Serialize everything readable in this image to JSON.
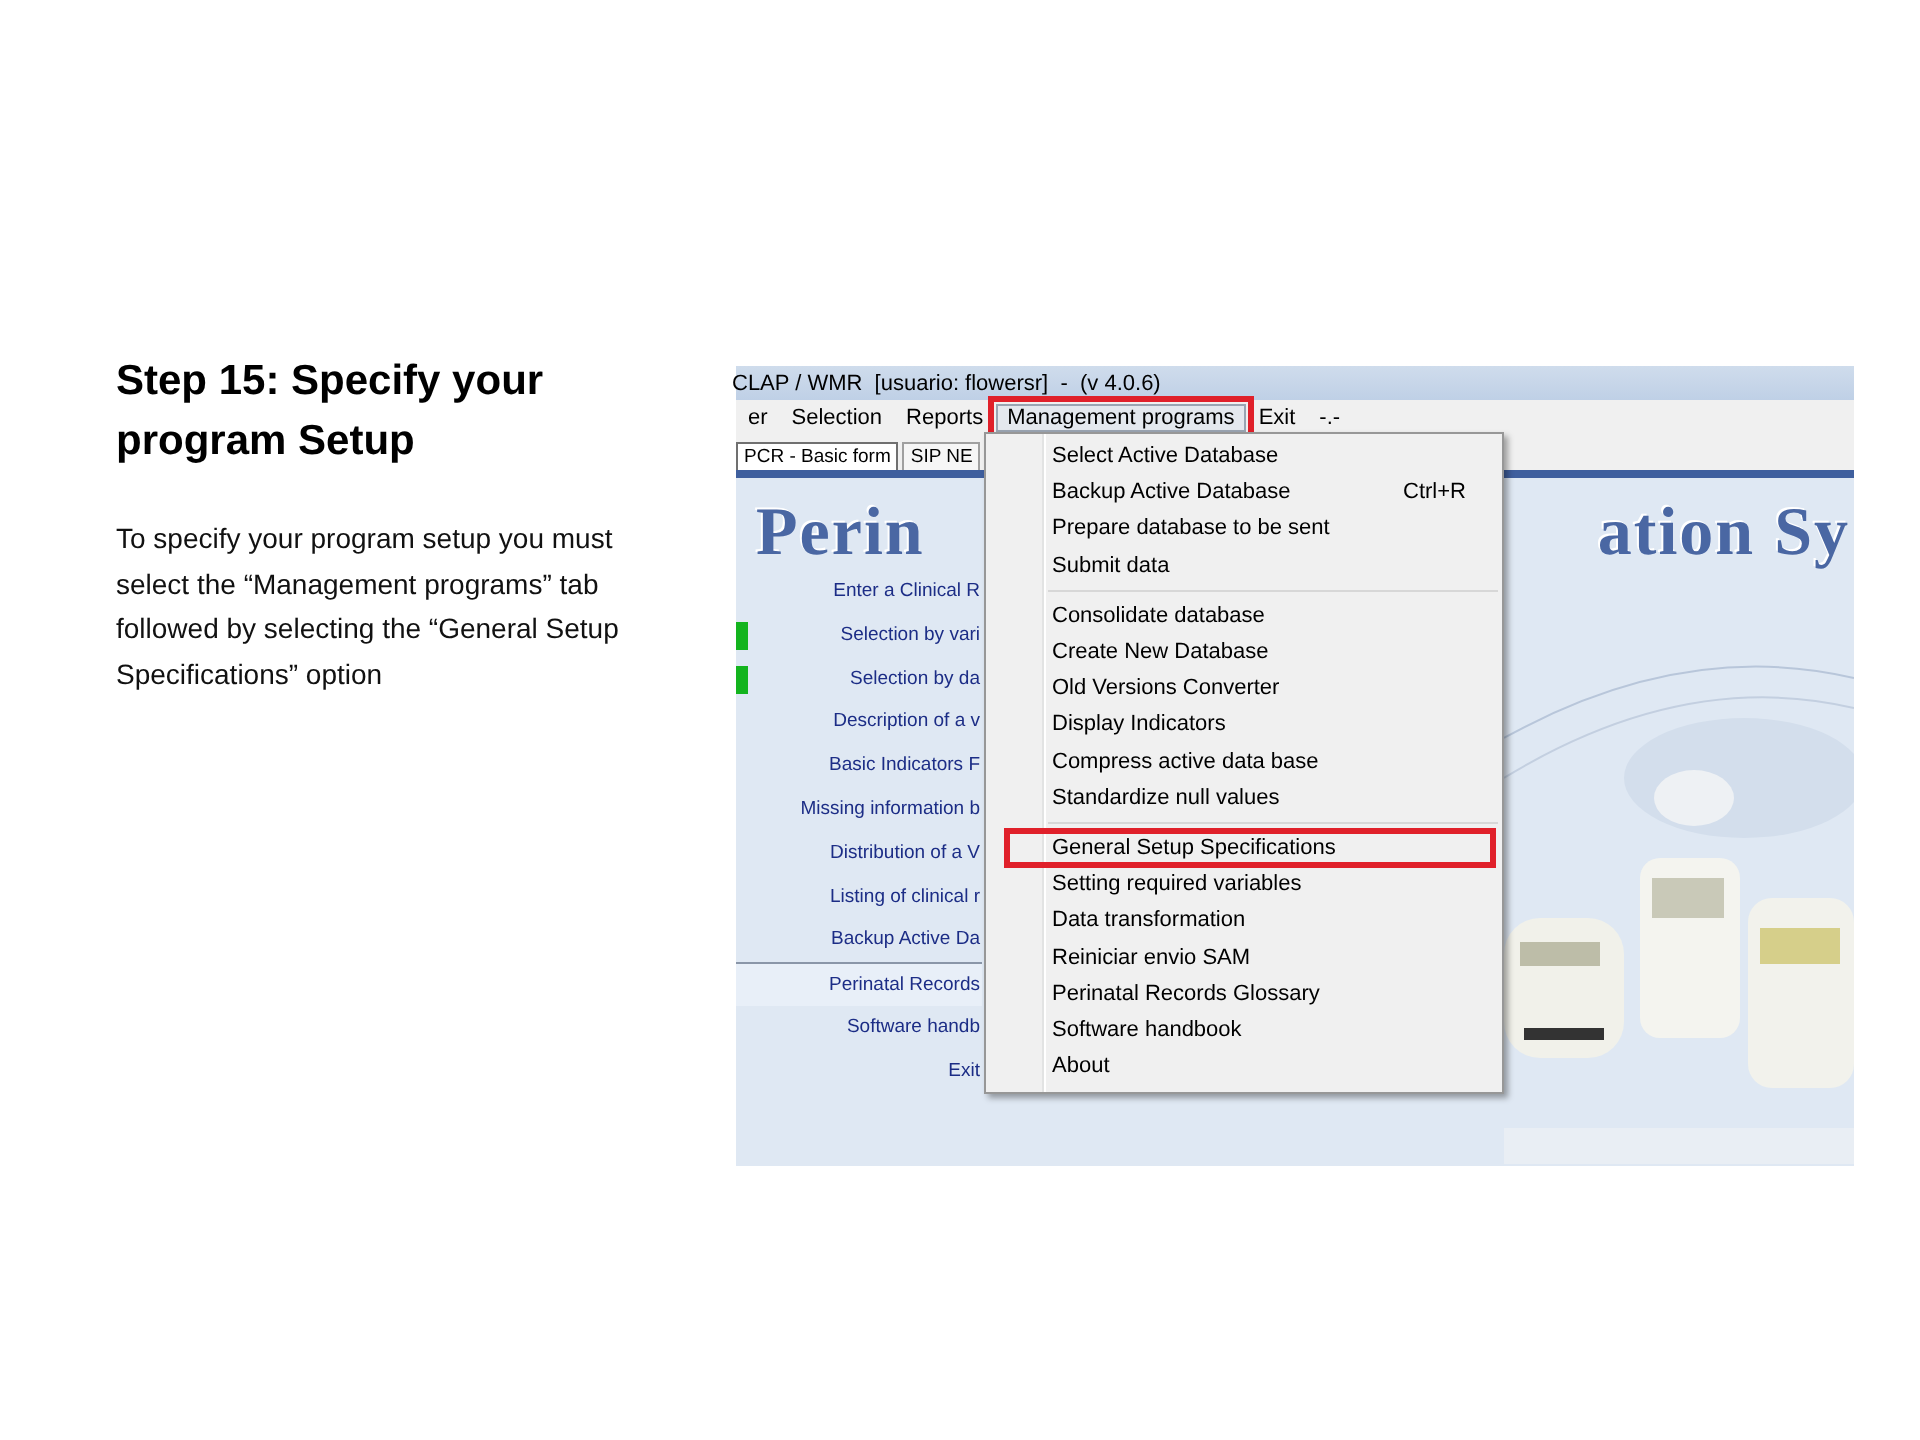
{
  "slide": {
    "title": "Step 15: Specify your program Setup",
    "body": "To specify your program setup you must select the “Management programs” tab followed by selecting the “General Setup Specifications” option"
  },
  "screenshot": {
    "window_title": "CLAP / WMR  [usuario: flowersr]  -  (v 4.0.6)",
    "menu": [
      {
        "label": "er",
        "selected": false,
        "annotated": false
      },
      {
        "label": "Selection",
        "selected": false,
        "annotated": false
      },
      {
        "label": "Reports",
        "selected": false,
        "annotated": false
      },
      {
        "label": "Management programs",
        "selected": true,
        "annotated": true
      },
      {
        "label": "Exit",
        "selected": false,
        "annotated": false
      },
      {
        "label": "-.-",
        "selected": false,
        "annotated": false
      }
    ],
    "tabs": [
      {
        "label": "PCR - Basic form",
        "selected": true
      },
      {
        "label": "SIP NE",
        "selected": false
      }
    ],
    "banner": [
      "Perin",
      "ation Sy"
    ],
    "nav_items": [
      {
        "label": "Enter a Clinical R",
        "selected": false,
        "flag": false
      },
      {
        "label": "Selection by vari",
        "selected": false,
        "flag": true
      },
      {
        "label": "Selection by da",
        "selected": false,
        "flag": true
      },
      {
        "label": "Description of a v",
        "selected": false,
        "flag": false
      },
      {
        "label": "Basic Indicators F",
        "selected": false,
        "flag": false
      },
      {
        "label": "Missing information b",
        "selected": false,
        "flag": false
      },
      {
        "label": "Distribution of a V",
        "selected": false,
        "flag": false
      },
      {
        "label": "Listing of clinical r",
        "selected": false,
        "flag": false
      },
      {
        "label": "Backup Active Da",
        "selected": false,
        "flag": false
      },
      {
        "label": "Perinatal Records",
        "selected": true,
        "flag": false
      },
      {
        "label": "Software handb",
        "selected": false,
        "flag": false
      },
      {
        "label": "Exit",
        "selected": false,
        "flag": false
      }
    ],
    "dropdown": [
      [
        {
          "label": "Select Active Database",
          "annotated": false
        },
        {
          "label": "Backup Active Database",
          "shortcut": "Ctrl+R",
          "annotated": false
        },
        {
          "label": "Prepare database to be sent",
          "annotated": false
        },
        {
          "label": "Submit data",
          "annotated": false
        }
      ],
      [
        {
          "label": "Consolidate database",
          "annotated": false
        },
        {
          "label": "Create New  Database",
          "annotated": false
        },
        {
          "label": "Old Versions Converter",
          "annotated": false
        },
        {
          "label": "Display Indicators",
          "annotated": false
        },
        {
          "label": "Compress active data base",
          "annotated": false
        },
        {
          "label": "Standardize null values",
          "annotated": false
        }
      ],
      [
        {
          "label": "General Setup Specifications",
          "annotated": true
        },
        {
          "label": "Setting required variables",
          "annotated": false
        },
        {
          "label": "Data transformation",
          "annotated": false
        },
        {
          "label": "Reiniciar envio SAM",
          "annotated": false
        },
        {
          "label": "Perinatal Records Glossary",
          "annotated": false
        },
        {
          "label": "Software handbook",
          "annotated": false
        },
        {
          "label": "About",
          "annotated": false
        }
      ]
    ]
  }
}
